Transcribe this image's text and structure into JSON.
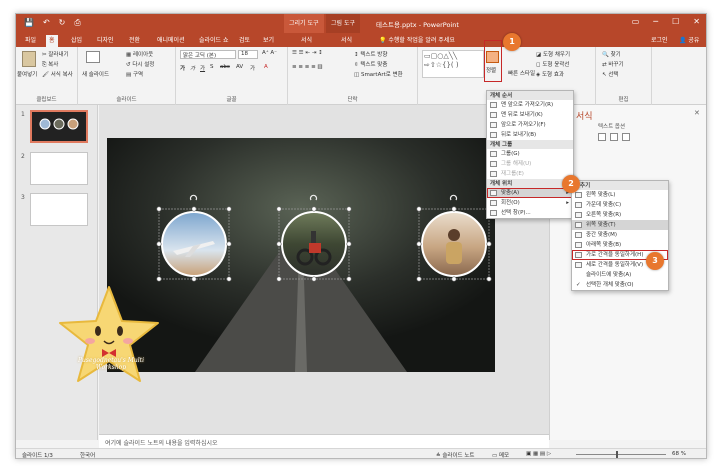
{
  "titlebar": {
    "qat": [
      "💾",
      "↶",
      "↻",
      "⎙"
    ],
    "ctx1": "그리기 도구",
    "ctx2": "그림 도구",
    "doc": "테스트용.pptx - PowerPoint",
    "login": "로그인",
    "share": "공유"
  },
  "tabs": [
    "파일",
    "홈",
    "삽입",
    "디자인",
    "전환",
    "애니메이션",
    "슬라이드 쇼",
    "검토",
    "보기",
    "서식",
    "서식"
  ],
  "search": "수행할 작업을 알려 주세요",
  "ribbon": {
    "clipboard": {
      "paste": "붙여넣기",
      "cut": "잘라내기",
      "copy": "복사",
      "format_painter": "서식 복사",
      "label": "클립보드"
    },
    "slides": {
      "new_slide": "새 슬라이드",
      "layout": "레이아웃",
      "reset": "다시 설정",
      "section": "구역",
      "label": "슬라이드"
    },
    "font": {
      "font_name": "맑은 고딕 (본)",
      "font_size": "18",
      "label": "글꼴"
    },
    "paragraph": {
      "text_dir": "텍스트 방향",
      "align_text": "텍스트 맞춤",
      "smartart": "SmartArt로 변환",
      "label": "단락"
    },
    "drawing": {
      "arrange": "정렬",
      "quick_styles": "빠른 스타일",
      "fill": "도형 채우기",
      "outline": "도형 윤곽선",
      "effects": "도형 효과"
    },
    "editing": {
      "find": "찾기",
      "replace": "바꾸기",
      "select": "선택",
      "label": "편집"
    }
  },
  "slides_panel": {
    "numbers": [
      "1",
      "2",
      "3"
    ]
  },
  "notes": "여기에 슬라이드 노트의 내용을 입력하십시오",
  "status": {
    "slide": "슬라이드 1/3",
    "lang": "한국어",
    "notes_btn": "슬라이드 노트",
    "comments_btn": "메모",
    "zoom": "68 %"
  },
  "right_pane": {
    "title": "서식",
    "subtitle": "텍스트 옵션"
  },
  "arrange_menu": {
    "sec1": "개체 순서",
    "order": [
      "맨 앞으로 가져오기(R)",
      "맨 뒤로 보내기(K)",
      "앞으로 가져오기(F)",
      "뒤로 보내기(B)"
    ],
    "sec2": "개체 그룹",
    "group": [
      "그룹(G)",
      "그룹 해제(U)",
      "재그룹(E)"
    ],
    "sec3": "개체 위치",
    "position": [
      "맞춤(A)",
      "회전(O)",
      "선택 창(P)..."
    ]
  },
  "align_menu": {
    "header": "맞추기",
    "items": [
      "왼쪽 맞춤(L)",
      "가운데 맞춤(C)",
      "오른쪽 맞춤(R)",
      "위쪽 맞춤(T)",
      "중간 맞춤(M)",
      "아래쪽 맞춤(B)",
      "가로 간격을 동일하게(H)",
      "세로 간격을 동일하게(V)",
      "슬라이드에 맞춤(A)",
      "선택한 개체 맞춤(O)"
    ]
  },
  "callouts": [
    "1",
    "2",
    "3"
  ],
  "watermark": "Pusegodnetau's Multi Workshop",
  "colors": {
    "accent": "#b7472a",
    "callout": "#e8772e",
    "highlight": "#c62828"
  }
}
